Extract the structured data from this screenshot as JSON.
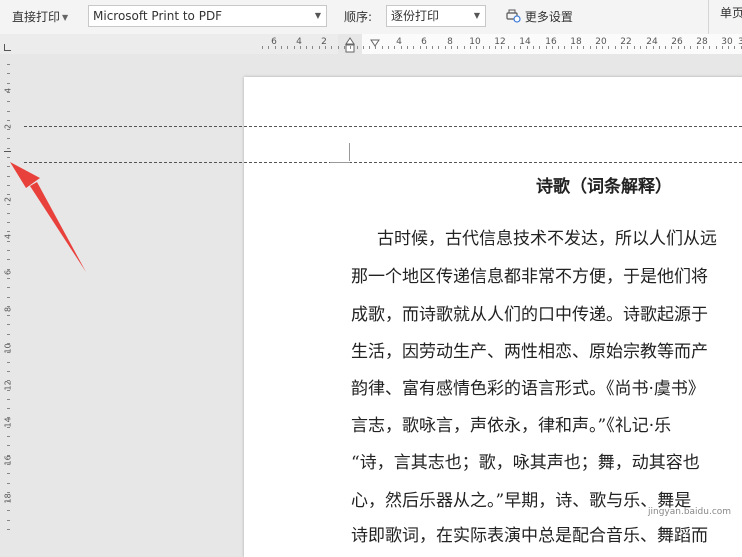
{
  "toolbar": {
    "print_mode": "直接打印",
    "printer": "Microsoft Print to PDF",
    "order_label": "顺序:",
    "order_value": "逐份打印",
    "more_settings": "更多设置",
    "single_page": "单页"
  },
  "hruler": {
    "left_labels": [
      "6",
      "4",
      "2"
    ],
    "right_labels": [
      "4",
      "6",
      "8",
      "10",
      "12",
      "14",
      "16",
      "18",
      "20",
      "22",
      "24",
      "26",
      "28",
      "30",
      "3"
    ]
  },
  "vruler": {
    "labels": [
      "4",
      "2",
      "2",
      "4",
      "6",
      "8",
      "10",
      "12",
      "14",
      "16",
      "18"
    ]
  },
  "document": {
    "title": "诗歌（词条解释）",
    "lines": [
      "古时候，古代信息技术不发达，所以人们从远",
      "那一个地区传递信息都非常不方便，于是他们将",
      "成歌，而诗歌就从人们的口中传递。诗歌起源于",
      "生活，因劳动生产、两性相恋、原始宗教等而产",
      "韵律、富有感情色彩的语言形式。《尚书·虞书》",
      "言志，歌咏言，声依永，律和声。”《礼记·乐",
      "“诗，言其志也；歌，咏其声也；舞，动其容也",
      "心，然后乐器从之。”早期，诗、歌与乐、舞是",
      "诗即歌词，在实际表演中总是配合音乐、舞蹈而"
    ]
  },
  "watermark": "jingyan.baidu.com",
  "colors": {
    "arrow": "#e8413c",
    "toolbar_bg": "#f4f4f4",
    "canvas_bg": "#e7e7e7"
  }
}
